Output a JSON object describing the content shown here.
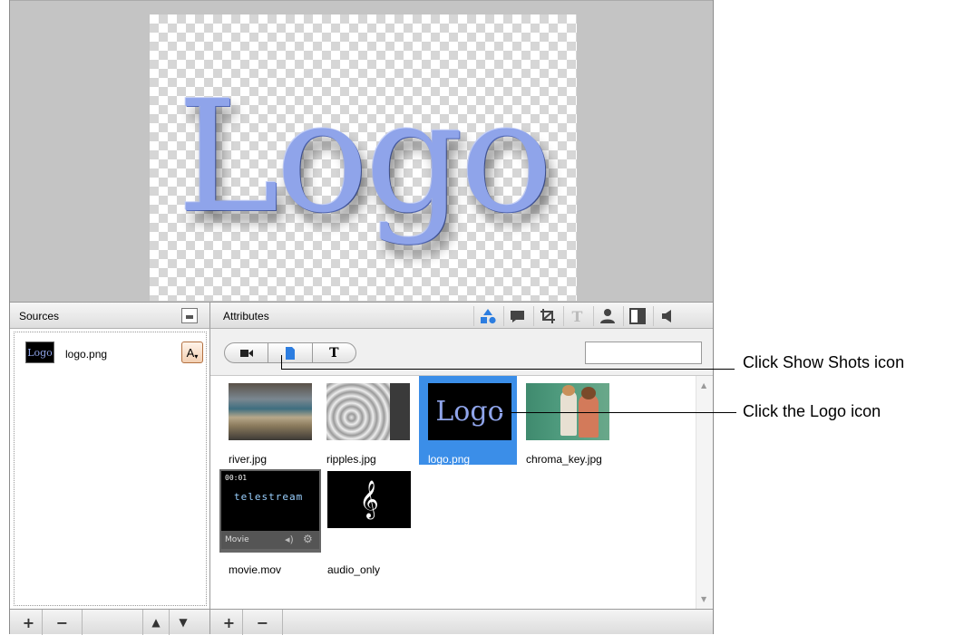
{
  "preview": {
    "logo_text": "Logo"
  },
  "sources": {
    "title": "Sources",
    "items": [
      {
        "name": "logo.png",
        "thumb_text": "Logo",
        "badge": "A"
      }
    ]
  },
  "attributes": {
    "title": "Attributes",
    "tool_icons": [
      "shapes-icon",
      "caption-icon",
      "crop-icon",
      "text-icon",
      "person-icon",
      "split-icon",
      "speaker-icon"
    ],
    "segments": [
      "video-camera-icon",
      "document-icon",
      "text-T-icon"
    ],
    "segment_T": "T",
    "filter_value": "",
    "media": [
      {
        "name": "river.jpg"
      },
      {
        "name": "ripples.jpg"
      },
      {
        "name": "logo.png",
        "thumb_text": "Logo",
        "selected": true
      },
      {
        "name": "chroma_key.jpg"
      },
      {
        "name": "movie.mov",
        "thumb_top": "00:01",
        "thumb_brand": "telestream",
        "thumb_footer": "Movie"
      },
      {
        "name": "audio_only"
      }
    ]
  },
  "bottom": {
    "plus": "+",
    "minus": "−",
    "up": "▲",
    "down": "▼"
  },
  "callouts": {
    "show_shots": "Click Show Shots icon",
    "logo_icon": "Click the Logo icon"
  },
  "colors": {
    "selection": "#3b8ee8",
    "logo_blue": "#8fa4ea"
  }
}
